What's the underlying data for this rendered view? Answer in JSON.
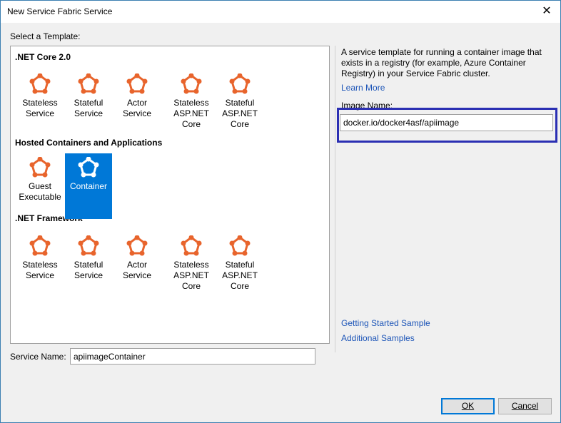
{
  "window": {
    "title": "New Service Fabric Service",
    "close_glyph": "✕"
  },
  "templates": {
    "label": "Select a Template:",
    "groups": [
      {
        "header": ".NET Core 2.0",
        "items": [
          {
            "label": "Stateless Service",
            "icon": "service-fabric-icon"
          },
          {
            "label": "Stateful Service",
            "icon": "service-fabric-icon"
          },
          {
            "label": "Actor Service",
            "icon": "service-fabric-icon"
          },
          {
            "label": "Stateless ASP.NET Core",
            "icon": "service-fabric-icon"
          },
          {
            "label": "Stateful ASP.NET Core",
            "icon": "service-fabric-icon"
          }
        ]
      },
      {
        "header": "Hosted Containers and Applications",
        "items": [
          {
            "label": "Guest Executable",
            "icon": "service-fabric-icon"
          },
          {
            "label": "Container",
            "icon": "service-fabric-icon",
            "selected": true
          }
        ]
      },
      {
        "header": ".NET Framework",
        "items": [
          {
            "label": "Stateless Service",
            "icon": "service-fabric-icon"
          },
          {
            "label": "Stateful Service",
            "icon": "service-fabric-icon"
          },
          {
            "label": "Actor Service",
            "icon": "service-fabric-icon"
          },
          {
            "label": "Stateless ASP.NET Core",
            "icon": "service-fabric-icon"
          },
          {
            "label": "Stateful ASP.NET Core",
            "icon": "service-fabric-icon"
          }
        ]
      }
    ]
  },
  "details": {
    "description": "A service template for running a container image that exists in a registry (for example, Azure Container Registry) in your Service Fabric cluster.",
    "learn_more": "Learn More",
    "image_name_label": "Image Name:",
    "image_name_value": "docker.io/docker4asf/apiimage",
    "getting_started": "Getting Started Sample",
    "additional_samples": "Additional Samples"
  },
  "service_name": {
    "label": "Service Name:",
    "value": "apiimageContainer"
  },
  "buttons": {
    "ok": "OK",
    "cancel": "Cancel"
  },
  "colors": {
    "icon_orange": "#e8642c",
    "selection_blue": "#0078d7",
    "highlight_border": "#2b2fb3",
    "link_blue": "#1e56b8"
  }
}
